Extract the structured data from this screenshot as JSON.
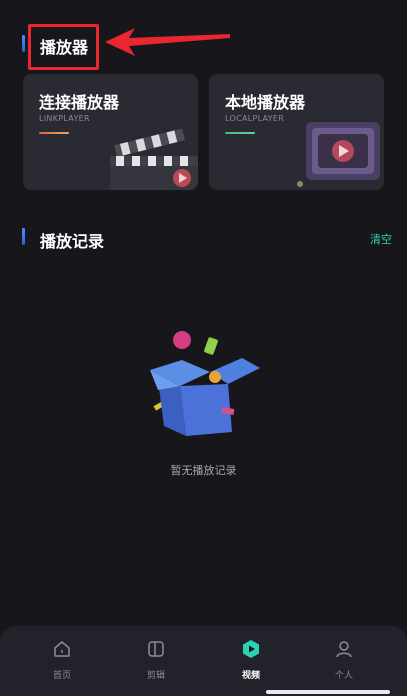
{
  "player_section": {
    "title": "播放器"
  },
  "cards": {
    "link": {
      "title": "连接播放器",
      "subtitle": "LINKPLAYER"
    },
    "local": {
      "title": "本地播放器",
      "subtitle": "LOCALPLAYER"
    }
  },
  "history_section": {
    "title": "播放记录",
    "clear_label": "清空"
  },
  "empty_state": {
    "text": "暂无播放记录"
  },
  "tabbar": {
    "tabs": [
      {
        "label": "首页",
        "icon": "home-icon",
        "active": false
      },
      {
        "label": "剪辑",
        "icon": "clip-icon",
        "active": false
      },
      {
        "label": "视频",
        "icon": "play-icon",
        "active": true
      },
      {
        "label": "个人",
        "icon": "person-icon",
        "active": false
      }
    ]
  },
  "colors": {
    "background": "#16161b",
    "card": "#2a2b32",
    "accent_teal": "#2ad3b5",
    "highlight_red": "#e8282e",
    "accent_blue": "#4a8dff"
  }
}
